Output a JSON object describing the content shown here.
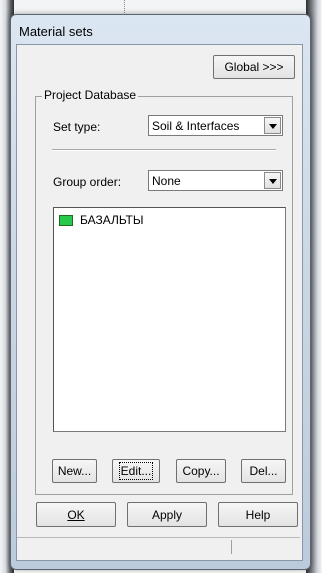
{
  "window": {
    "title": "Material sets"
  },
  "toolbar": {
    "global_label": "Global >>>"
  },
  "project_database": {
    "group_label": "Project Database",
    "set_type": {
      "label": "Set type:",
      "value": "Soil & Interfaces"
    },
    "group_order": {
      "label": "Group order:",
      "value": "None"
    },
    "items": [
      {
        "name": "БАЗАЛЬТЫ",
        "color": "#27c94b"
      }
    ],
    "buttons": {
      "new": "New...",
      "edit": "Edit...",
      "copy": "Copy...",
      "delete": "Del..."
    }
  },
  "dialog_buttons": {
    "ok": "OK",
    "apply": "Apply",
    "help": "Help"
  }
}
